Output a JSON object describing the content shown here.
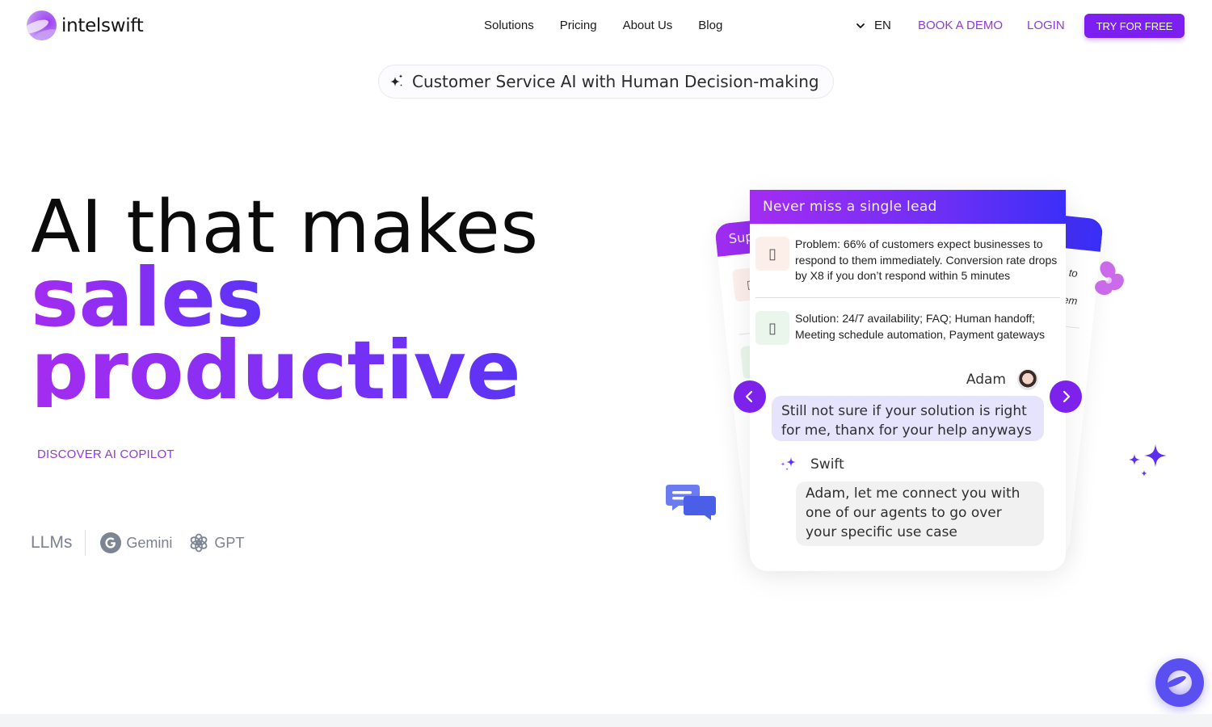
{
  "brand": {
    "name": "intelswift",
    "accent": "#7c1ff0",
    "link_color": "#8f3bd6"
  },
  "nav": {
    "items": [
      {
        "label": "Solutions"
      },
      {
        "label": "Pricing"
      },
      {
        "label": "About Us"
      },
      {
        "label": "Blog"
      }
    ],
    "language": "EN",
    "book_demo": "BOOK A DEMO",
    "login": "LOGIN",
    "try_free": "TRY FOR FREE"
  },
  "pill": {
    "icon": "sparkle-icon",
    "text": "Customer Service AI with Human Decision-making"
  },
  "hero": {
    "line1": "AI that makes",
    "line2": "sales",
    "line3": "productive",
    "cta": "DISCOVER AI COPILOT"
  },
  "llms": {
    "label": "LLMs",
    "items": [
      {
        "name": "Gemini",
        "icon": "google-icon"
      },
      {
        "name": "GPT",
        "icon": "openai-icon"
      }
    ]
  },
  "carousel": {
    "back_left_title": "Sup",
    "back_right_fragments": [
      "to",
      "em"
    ],
    "card": {
      "title": "Never miss a single lead",
      "problem": "Problem: 66% of customers expect businesses to respond to them immediately. Conversion rate drops by X8 if you don’t respond within 5 minutes",
      "solution": "Solution: 24/7 availability; FAQ; Human handoff; Meeting schedule automation, Payment gateways",
      "problem_icon_glyph": "▯",
      "solution_icon_glyph": "▯",
      "chat": {
        "user_name": "Adam",
        "user_message": "Still not sure if your solution is right for me, thanx for your help anyways",
        "bot_name": "Swift",
        "bot_message": "Adam, let me connect you with one of our agents to go over your specific use case"
      }
    },
    "prev_label": "Previous slide",
    "next_label": "Next slide"
  },
  "chat_widget": {
    "label": "Open chat"
  }
}
